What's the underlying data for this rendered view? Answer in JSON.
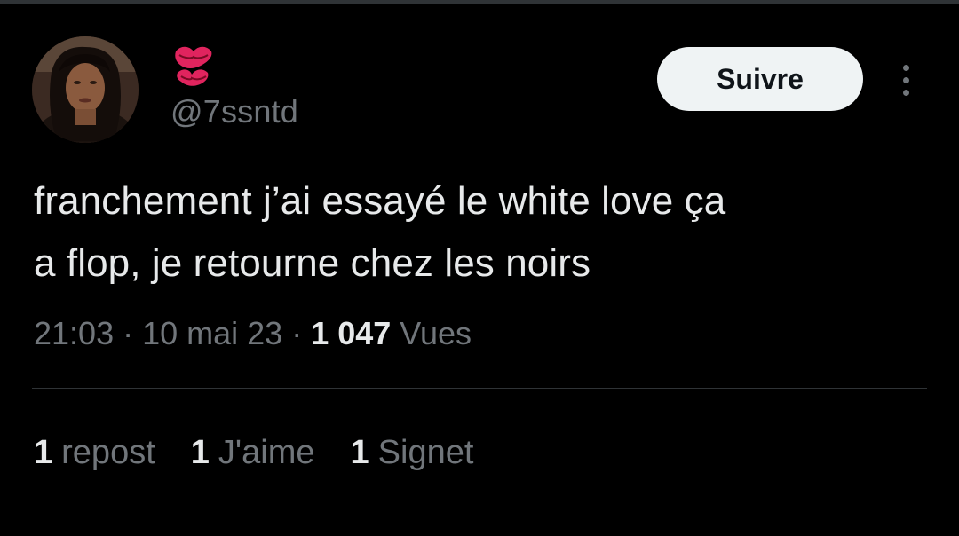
{
  "user": {
    "display_name_emoji": "kiss-mark-icon",
    "handle": "@7ssntd"
  },
  "actions": {
    "follow_label": "Suivre"
  },
  "tweet": {
    "text": "franchement j’ai essayé le white love ça\na flop, je retourne chez les noirs",
    "time": "21:03",
    "date": "10 mai 23",
    "separator": "·",
    "views_count": "1 047",
    "views_label": "Vues"
  },
  "stats": [
    {
      "count": "1",
      "label": "repost"
    },
    {
      "count": "1",
      "label": "J'aime"
    },
    {
      "count": "1",
      "label": "Signet"
    }
  ],
  "colors": {
    "background": "#000000",
    "text_primary": "#e7e9ea",
    "text_secondary": "#71767b",
    "divider": "#2f3336",
    "follow_button_bg": "#eff3f4",
    "emoji_red": "#e0245e"
  }
}
